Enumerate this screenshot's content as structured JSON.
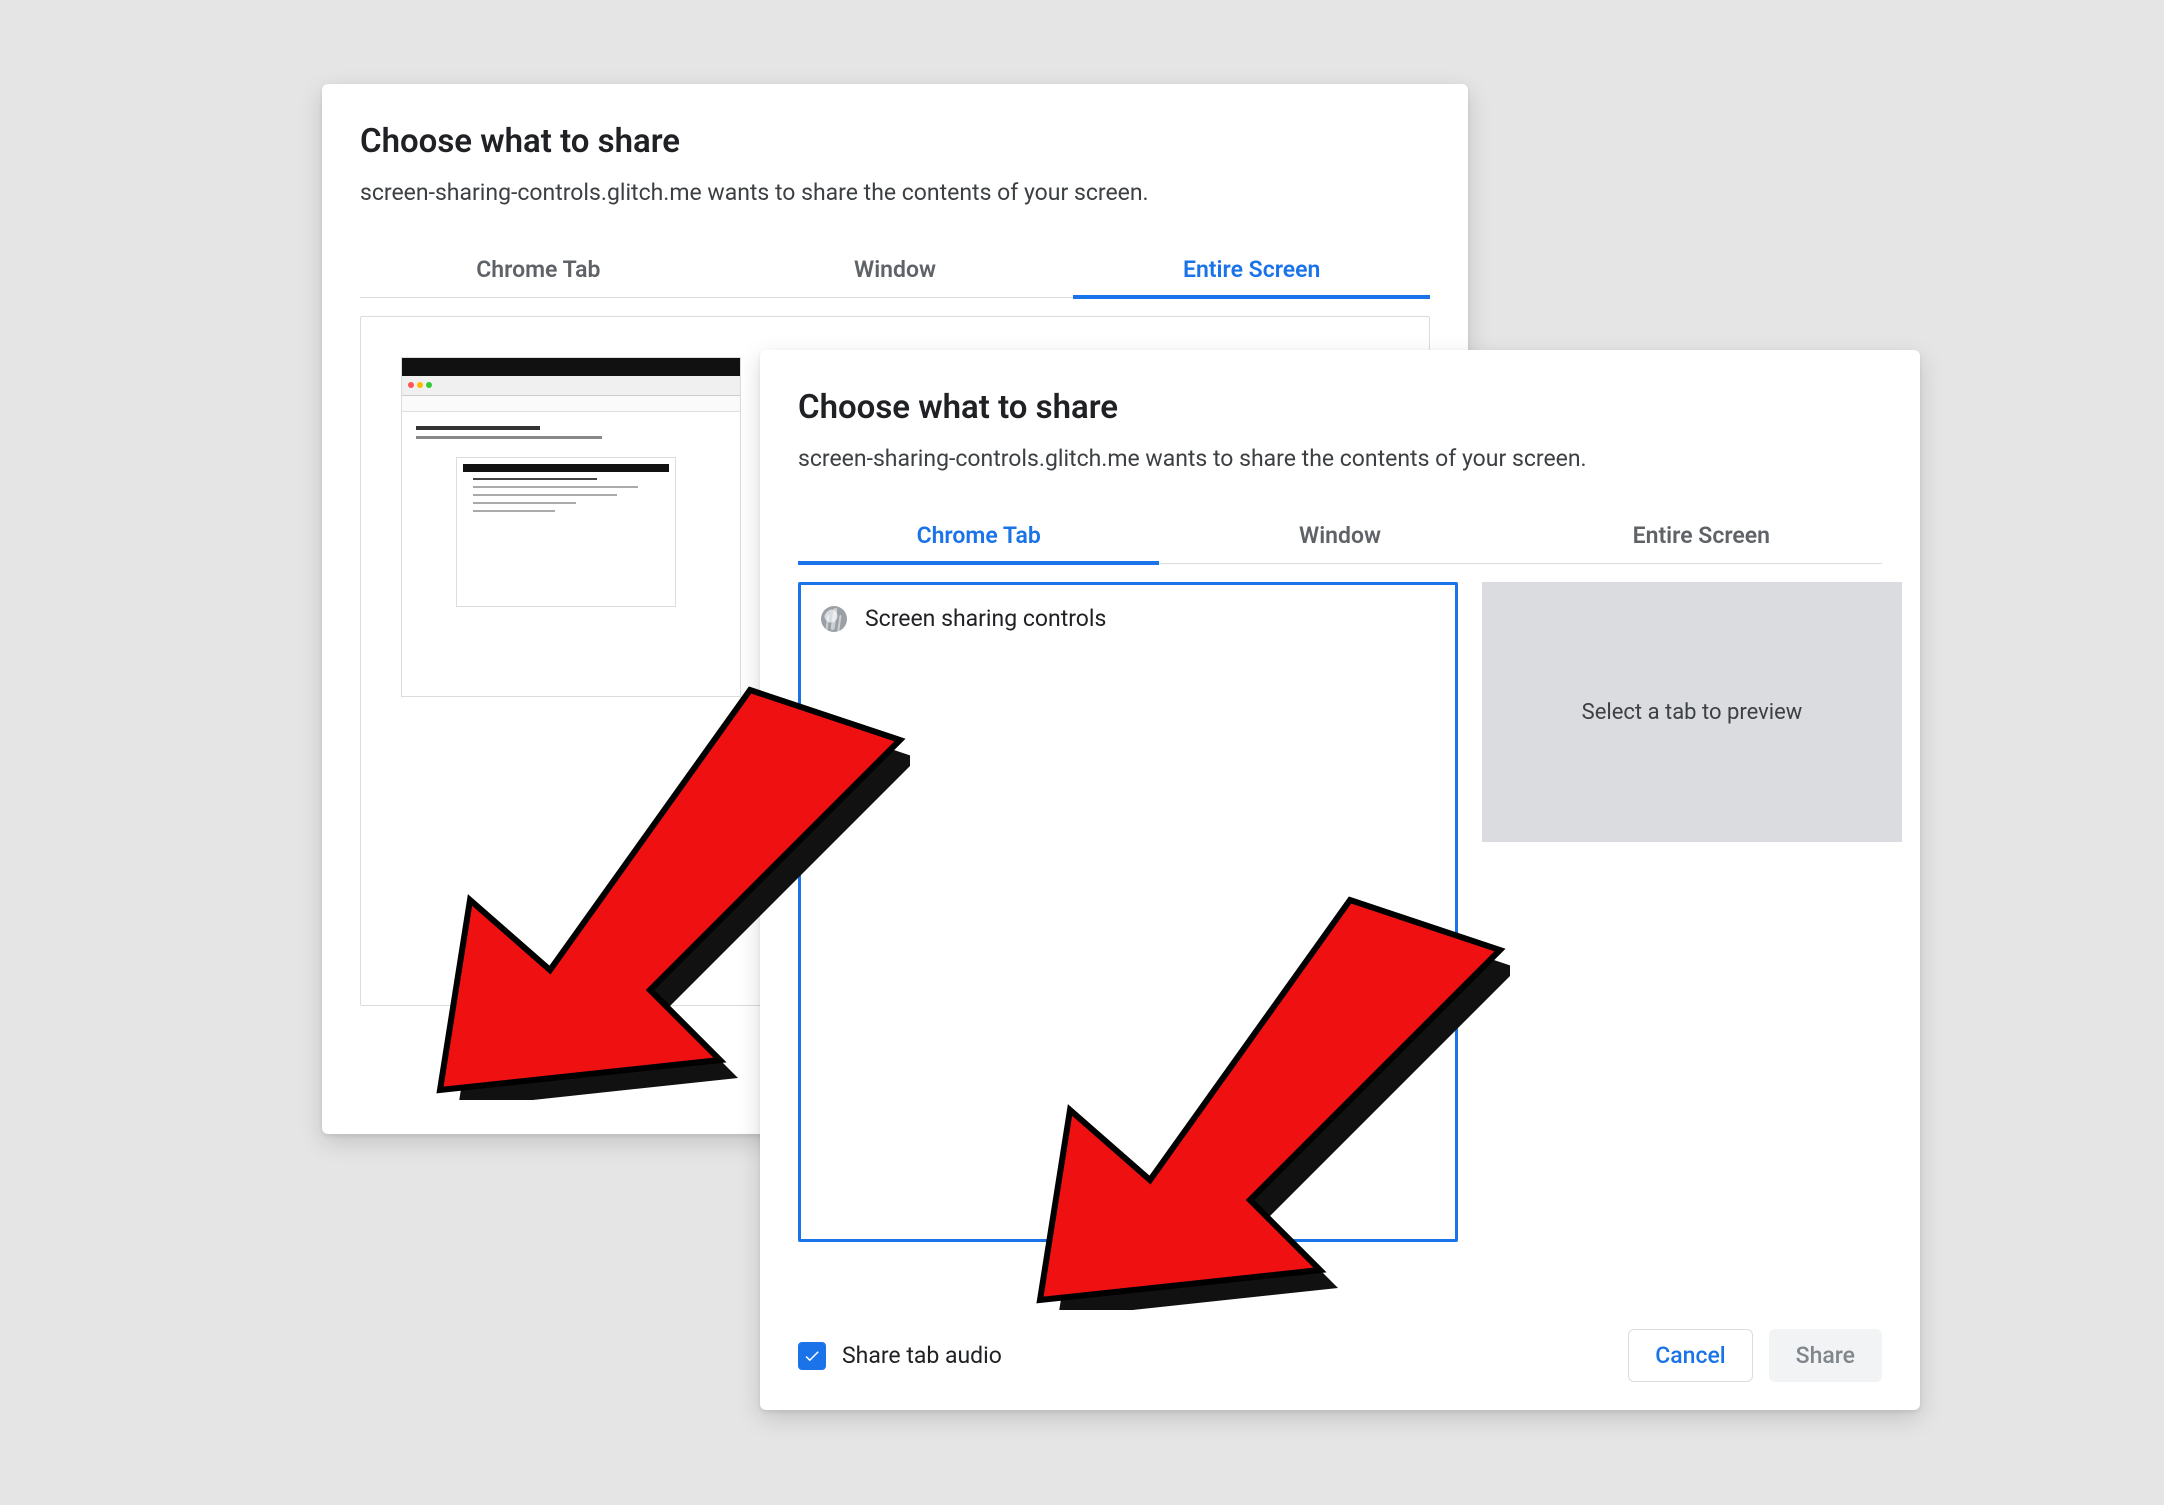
{
  "back": {
    "title": "Choose what to share",
    "subtitle": "screen-sharing-controls.glitch.me wants to share the contents of your screen.",
    "tabs": {
      "chrome": "Chrome Tab",
      "window": "Window",
      "entire": "Entire Screen"
    }
  },
  "front": {
    "title": "Choose what to share",
    "subtitle": "screen-sharing-controls.glitch.me wants to share the contents of your screen.",
    "tabs": {
      "chrome": "Chrome Tab",
      "window": "Window",
      "entire": "Entire Screen"
    },
    "tab_item": "Screen sharing controls",
    "preview_placeholder": "Select a tab to preview",
    "share_audio_label": "Share tab audio",
    "cancel": "Cancel",
    "share": "Share"
  }
}
